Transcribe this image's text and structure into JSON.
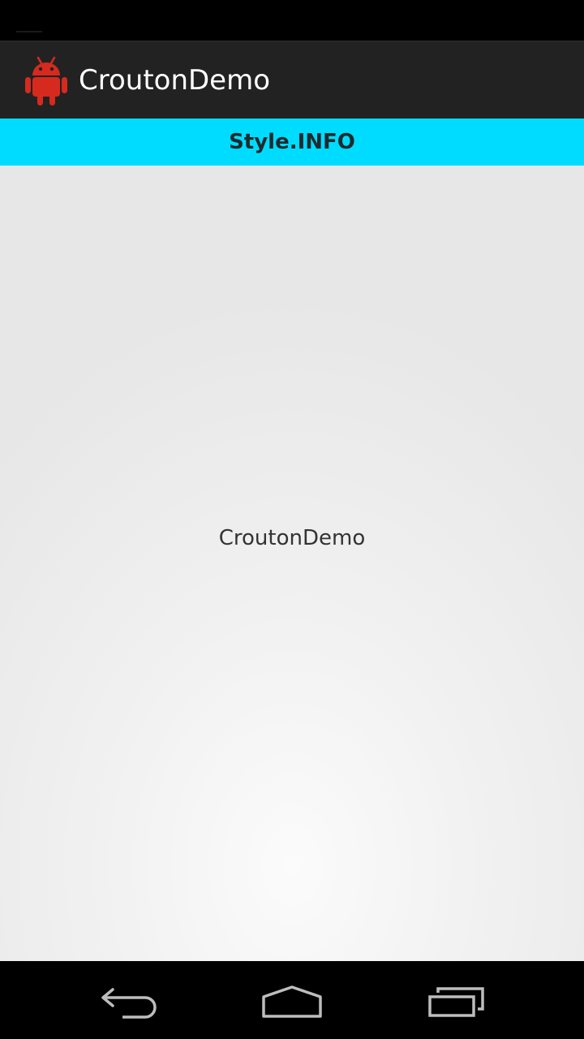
{
  "action_bar": {
    "title": "CroutonDemo",
    "icon": "android-robot-icon",
    "icon_color": "#d62a1e",
    "background": "#222222"
  },
  "crouton": {
    "text": "Style.INFO",
    "background": "#00dcff"
  },
  "content": {
    "label": "CroutonDemo"
  },
  "nav_bar": {
    "buttons": [
      {
        "name": "back",
        "icon": "back-arrow-icon"
      },
      {
        "name": "home",
        "icon": "home-icon"
      },
      {
        "name": "recents",
        "icon": "recent-apps-icon"
      }
    ]
  }
}
